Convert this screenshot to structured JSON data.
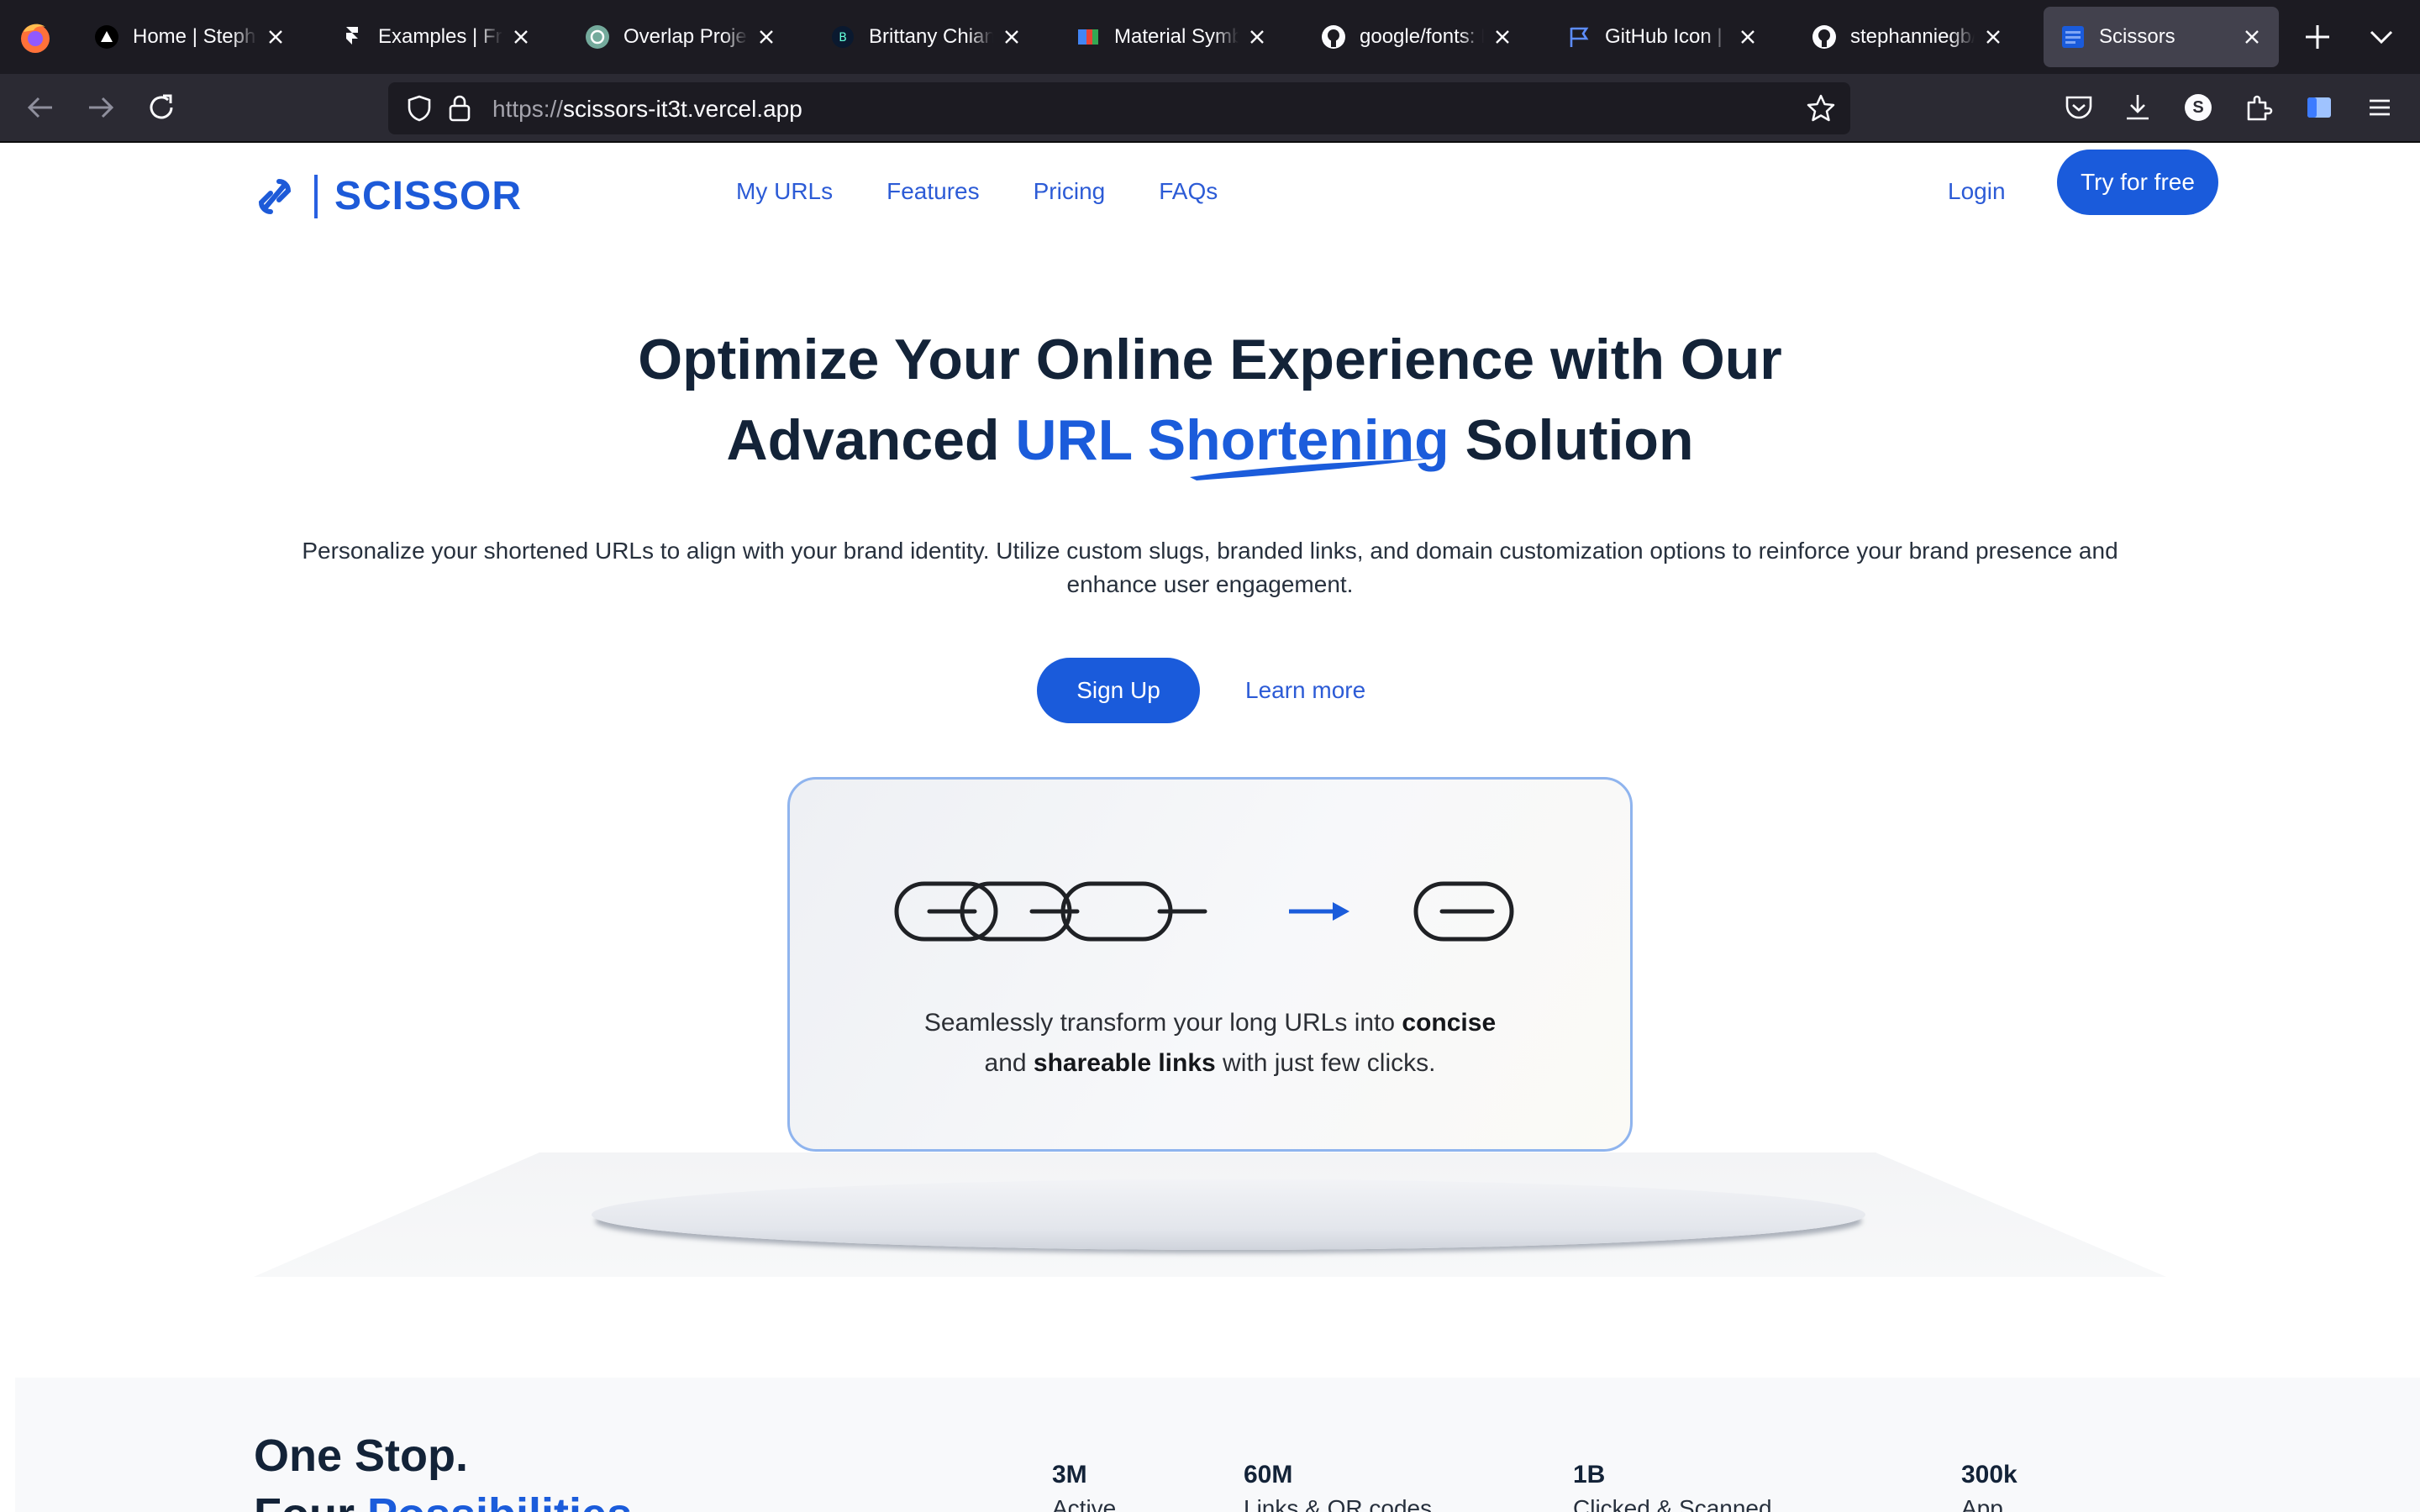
{
  "browser": {
    "tabs": [
      {
        "title": "Home | Stephanie",
        "icon": "triangle-icon"
      },
      {
        "title": "Examples | Framer",
        "icon": "framer-icon"
      },
      {
        "title": "Overlap Project Ch",
        "icon": "chatgpt-icon"
      },
      {
        "title": "Brittany Chiang",
        "icon": "brittany-b-icon"
      },
      {
        "title": "Material Symbols",
        "icon": "material-icon"
      },
      {
        "title": "google/fonts: Font",
        "icon": "github-icon"
      },
      {
        "title": "GitHub Icon | Font",
        "icon": "flag-icon"
      },
      {
        "title": "stephanniegb/sci",
        "icon": "github-icon"
      },
      {
        "title": "Scissors",
        "icon": "scissors-favicon",
        "active": true
      }
    ],
    "url_protocol": "https://",
    "url_host": "scissors-it3t.vercel.app",
    "profile_initial": "S"
  },
  "header": {
    "brand": "SCISSOR",
    "menu": [
      "My URLs",
      "Features",
      "Pricing",
      "FAQs"
    ],
    "login": "Login",
    "cta": "Try for free"
  },
  "hero": {
    "title_line1": "Optimize Your Online Experience with Our",
    "title_pre": "Advanced ",
    "title_highlight": "URL Shortening",
    "title_post": " Solution",
    "subtitle": "Personalize your shortened URLs to align with your brand identity. Utilize custom slugs, branded links, and domain customization options to reinforce your brand presence and enhance user engagement.",
    "primary_button": "Sign Up",
    "secondary_link": "Learn more"
  },
  "card": {
    "text_1": "Seamlessly transform your long URLs into ",
    "text_bold_1": "concise",
    "text_2": "and ",
    "text_bold_2": "shareable links",
    "text_3": " with just few clicks."
  },
  "stats_section": {
    "heading_line1": "One Stop.",
    "heading_line2_pre": "Four ",
    "heading_line2_highlight": "Possibilities.",
    "stats": [
      {
        "value": "3M",
        "label": "Active"
      },
      {
        "value": "60M",
        "label": "Links & QR codes"
      },
      {
        "value": "1B",
        "label": "Clicked & Scanned"
      },
      {
        "value": "300k",
        "label": "App"
      }
    ]
  },
  "colors": {
    "brand_blue": "#1a5bdb",
    "heading_navy": "#132338",
    "browser_dark": "#1c1b22"
  }
}
